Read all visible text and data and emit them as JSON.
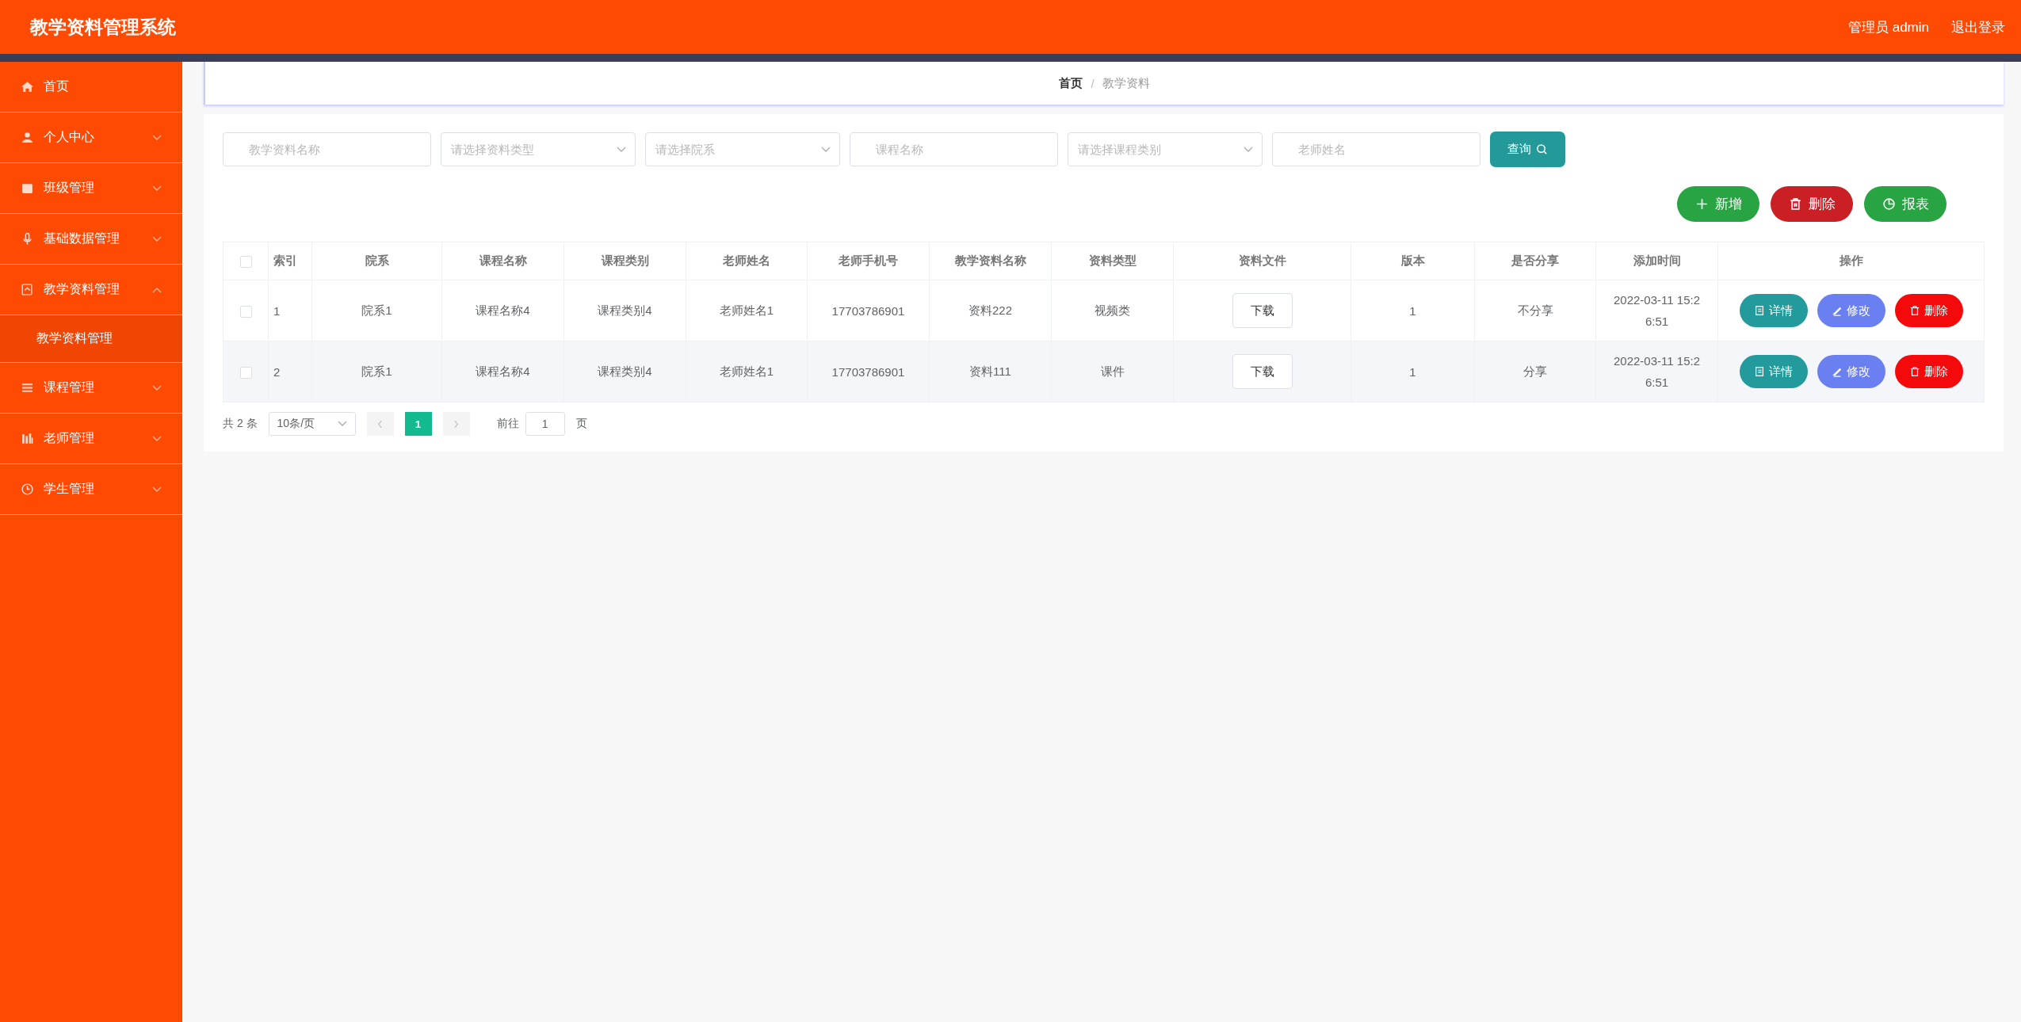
{
  "header": {
    "title": "教学资料管理系统",
    "user": "管理员 admin",
    "logout": "退出登录"
  },
  "sidebar": {
    "items": [
      {
        "kind": "link",
        "label": "首页"
      },
      {
        "kind": "group",
        "label": "个人中心",
        "expanded": false
      },
      {
        "kind": "group",
        "label": "班级管理",
        "expanded": false
      },
      {
        "kind": "group",
        "label": "基础数据管理",
        "expanded": false
      },
      {
        "kind": "group",
        "label": "教学资料管理",
        "expanded": true,
        "children": [
          {
            "label": "教学资料管理",
            "selected": true
          }
        ]
      },
      {
        "kind": "group",
        "label": "课程管理",
        "expanded": false
      },
      {
        "kind": "group",
        "label": "老师管理",
        "expanded": false
      },
      {
        "kind": "group",
        "label": "学生管理",
        "expanded": false
      }
    ]
  },
  "breadcrumb": {
    "items": [
      "首页",
      "教学资料"
    ],
    "separator": "/"
  },
  "filters": [
    {
      "kind": "input",
      "placeholder": "教学资料名称"
    },
    {
      "kind": "select",
      "placeholder": "请选择资料类型"
    },
    {
      "kind": "select",
      "placeholder": "请选择院系"
    },
    {
      "kind": "input",
      "placeholder": "课程名称"
    },
    {
      "kind": "select",
      "placeholder": "请选择课程类别"
    },
    {
      "kind": "input",
      "placeholder": "老师姓名"
    }
  ],
  "search_button": "查询",
  "actions": [
    {
      "kind": "add",
      "label": "新增"
    },
    {
      "kind": "delete",
      "label": "删除"
    },
    {
      "kind": "report",
      "label": "报表"
    }
  ],
  "table": {
    "all_checked": false,
    "columns": [
      "索引",
      "院系",
      "课程名称",
      "课程类别",
      "老师姓名",
      "老师手机号",
      "教学资料名称",
      "资料类型",
      "资料文件",
      "版本",
      "是否分享",
      "添加时间",
      "操作"
    ],
    "rows": [
      {
        "checked": false,
        "cells": [
          "1",
          "院系1",
          "课程名称4",
          "课程类别4",
          "老师姓名1",
          "17703786901",
          "资料222",
          "视频类"
        ],
        "file": "下载",
        "version": "1",
        "share": "不分享",
        "time": "2022-03-11 15:26:51",
        "ops": [
          {
            "kind": "detail",
            "label": "详情"
          },
          {
            "kind": "edit",
            "label": "修改"
          },
          {
            "kind": "delete",
            "label": "删除"
          }
        ]
      },
      {
        "checked": false,
        "cells": [
          "2",
          "院系1",
          "课程名称4",
          "课程类别4",
          "老师姓名1",
          "17703786901",
          "资料111",
          "课件"
        ],
        "file": "下载",
        "version": "1",
        "share": "分享",
        "time": "2022-03-11 15:26:51",
        "ops": [
          {
            "kind": "detail",
            "label": "详情"
          },
          {
            "kind": "edit",
            "label": "修改"
          },
          {
            "kind": "delete",
            "label": "删除"
          }
        ]
      }
    ]
  },
  "pagination": {
    "total": "共 2 条",
    "page_size": "10条/页",
    "pages": [
      {
        "label": "1",
        "selected": true
      }
    ],
    "goto_label": "前往",
    "goto_value": "1",
    "goto_suffix": "页"
  }
}
